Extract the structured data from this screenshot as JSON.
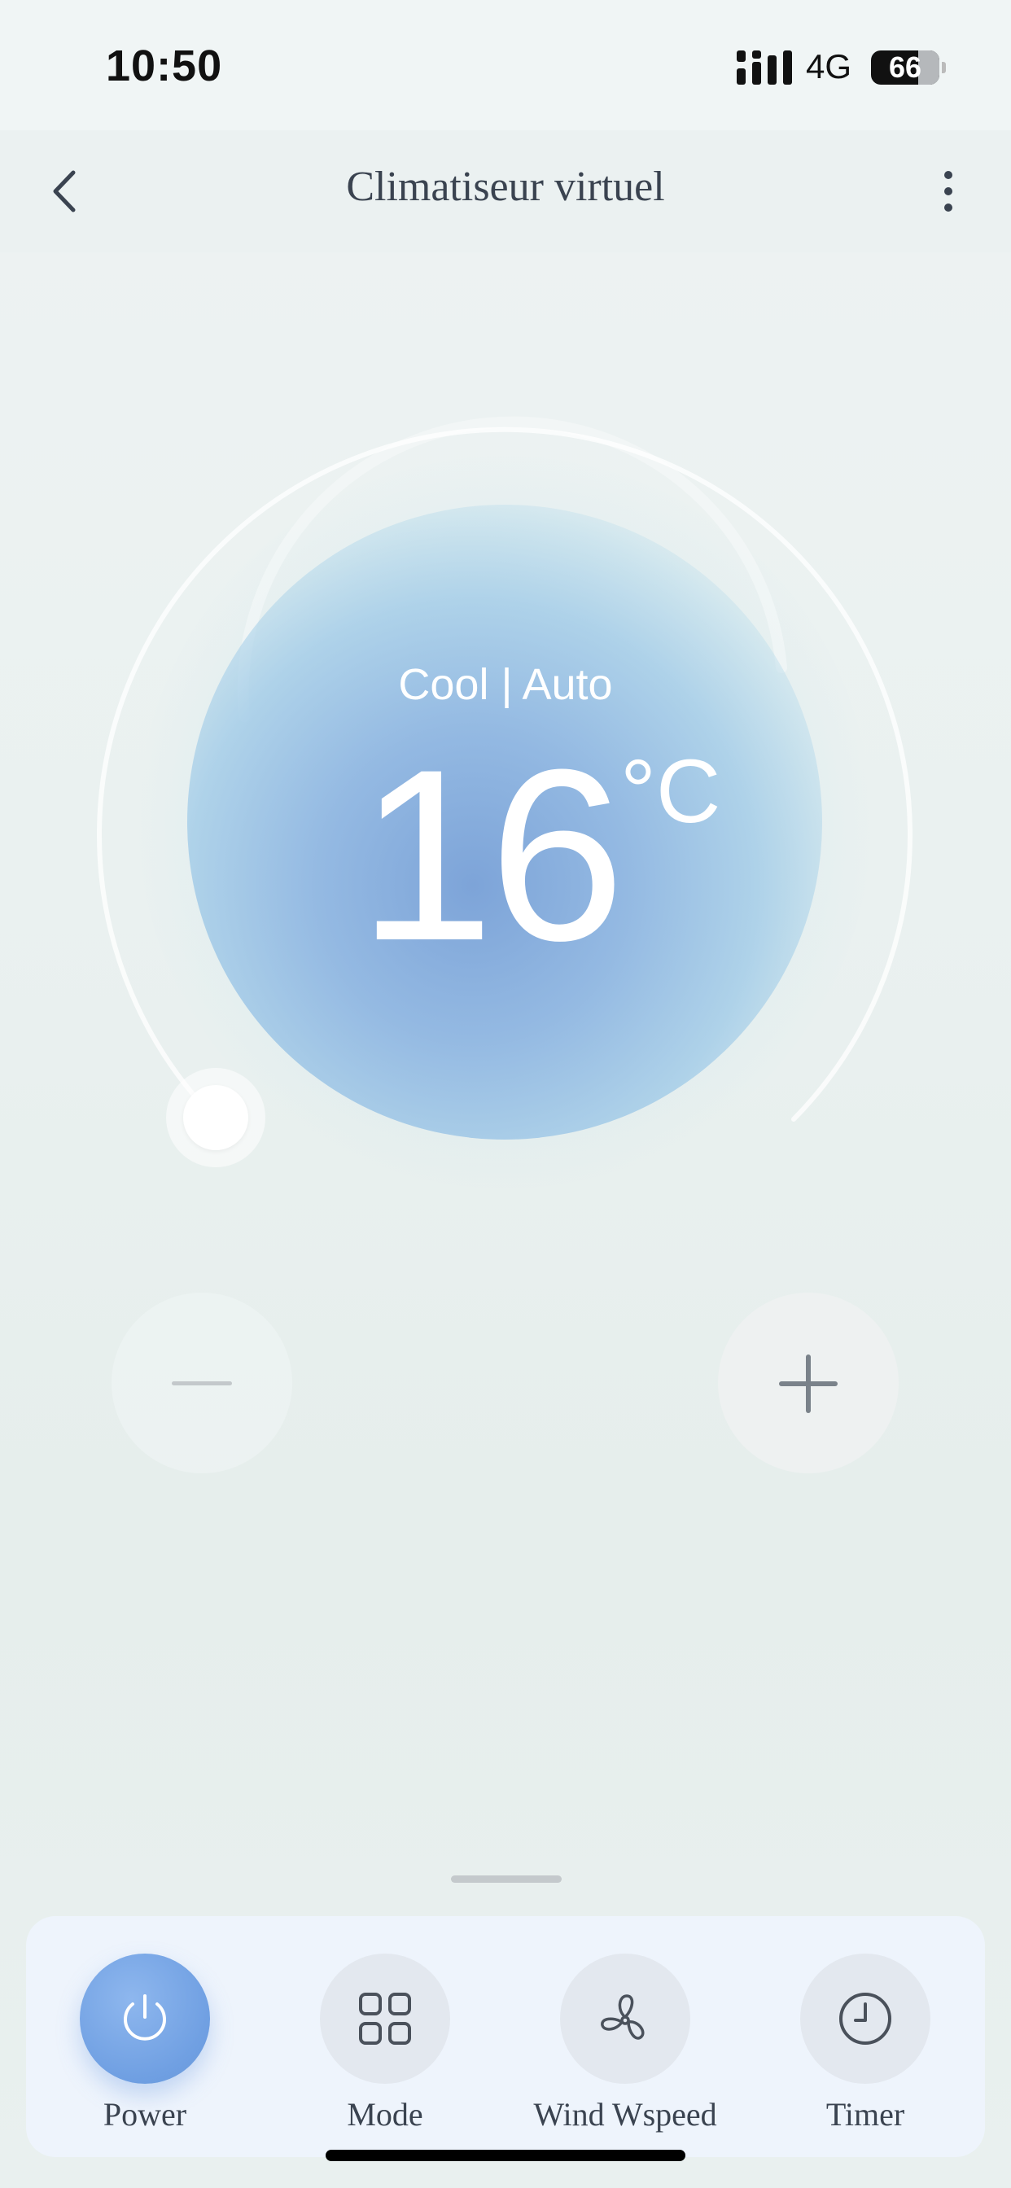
{
  "status_bar": {
    "time": "10:50",
    "network": "4G",
    "battery": "66"
  },
  "nav": {
    "title": "Climatiseur virtuel"
  },
  "thermostat": {
    "mode_text": "Cool | Auto",
    "temperature": "16",
    "unit": "°C"
  },
  "actions": [
    {
      "label": "Power",
      "icon": "power-icon",
      "active": true
    },
    {
      "label": "Mode",
      "icon": "grid-icon",
      "active": false
    },
    {
      "label": "Wind Wspeed",
      "icon": "fan-icon",
      "active": false
    },
    {
      "label": "Timer",
      "icon": "clock-icon",
      "active": false
    }
  ],
  "colors": {
    "accent": "#6f9fe2",
    "orb": "#8cb4e0"
  }
}
